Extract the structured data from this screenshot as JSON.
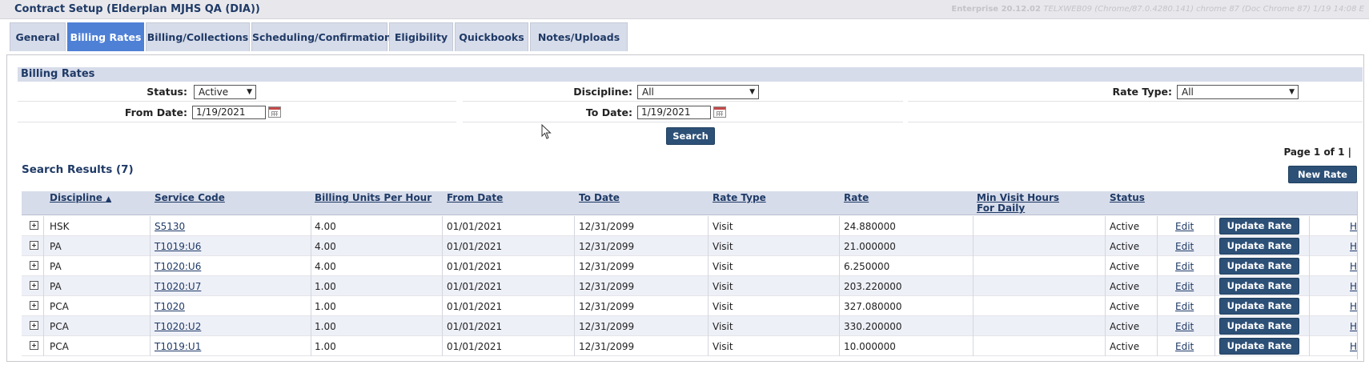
{
  "window": {
    "title": "Contract Setup (Elderplan MJHS QA (DIA))",
    "version_prefix": "Enterprise 20.12.02 ",
    "version_detail": "TELXWEB09 (Chrome/87.0.4280.141) chrome 87 (Doc Chrome 87) 1/19 14:08 E"
  },
  "tabs": [
    {
      "label": "General",
      "active": false
    },
    {
      "label": "Billing Rates",
      "active": true
    },
    {
      "label": "Billing/Collections",
      "active": false
    },
    {
      "label": "Scheduling/Confirmation",
      "active": false
    },
    {
      "label": "Eligibility",
      "active": false
    },
    {
      "label": "Quickbooks",
      "active": false
    },
    {
      "label": "Notes/Uploads",
      "active": false
    }
  ],
  "filters": {
    "section_title": "Billing Rates",
    "status_label": "Status:",
    "status_value": "Active",
    "discipline_label": "Discipline:",
    "discipline_value": "All",
    "rate_type_label": "Rate Type:",
    "rate_type_value": "All",
    "from_date_label": "From Date:",
    "from_date_value": "1/19/2021",
    "to_date_label": "To Date:",
    "to_date_value": "1/19/2021",
    "search_button": "Search"
  },
  "results": {
    "title": "Search Results (7)",
    "pager": "Page 1 of 1 |",
    "new_rate_button": "New Rate",
    "columns": {
      "discipline": "Discipline",
      "service_code": "Service Code",
      "billing_units": "Billing Units Per Hour",
      "from_date": "From Date",
      "to_date": "To Date",
      "rate_type": "Rate Type",
      "rate": "Rate",
      "min_visit_1": "Min Visit Hours",
      "min_visit_2": "For Daily",
      "status": "Status"
    },
    "sort_indicator": "▲",
    "edit_label": "Edit",
    "update_label": "Update Rate",
    "history_label": "H",
    "rows": [
      {
        "discipline": "HSK",
        "service_code": "S5130",
        "units": "4.00",
        "from": "01/01/2021",
        "to": "12/31/2099",
        "rate_type": "Visit",
        "rate": "24.880000",
        "status": "Active"
      },
      {
        "discipline": "PA",
        "service_code": "T1019:U6",
        "units": "4.00",
        "from": "01/01/2021",
        "to": "12/31/2099",
        "rate_type": "Visit",
        "rate": "21.000000",
        "status": "Active"
      },
      {
        "discipline": "PA",
        "service_code": "T1020:U6",
        "units": "4.00",
        "from": "01/01/2021",
        "to": "12/31/2099",
        "rate_type": "Visit",
        "rate": "6.250000",
        "status": "Active"
      },
      {
        "discipline": "PA",
        "service_code": "T1020:U7",
        "units": "1.00",
        "from": "01/01/2021",
        "to": "12/31/2099",
        "rate_type": "Visit",
        "rate": "203.220000",
        "status": "Active"
      },
      {
        "discipline": "PCA",
        "service_code": "T1020",
        "units": "1.00",
        "from": "01/01/2021",
        "to": "12/31/2099",
        "rate_type": "Visit",
        "rate": "327.080000",
        "status": "Active"
      },
      {
        "discipline": "PCA",
        "service_code": "T1020:U2",
        "units": "1.00",
        "from": "01/01/2021",
        "to": "12/31/2099",
        "rate_type": "Visit",
        "rate": "330.200000",
        "status": "Active"
      },
      {
        "discipline": "PCA",
        "service_code": "T1019:U1",
        "units": "1.00",
        "from": "01/01/2021",
        "to": "12/31/2099",
        "rate_type": "Visit",
        "rate": "10.000000",
        "status": "Active"
      }
    ]
  }
}
